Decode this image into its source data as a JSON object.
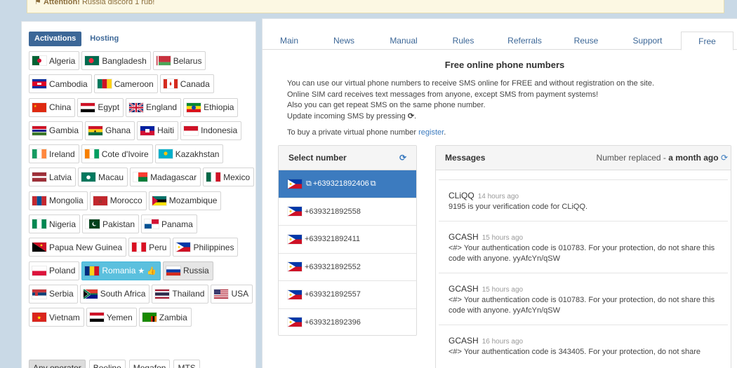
{
  "attention": {
    "label": "Attention!",
    "text": "Russia discord 1 rub!"
  },
  "left_tabs": [
    "Activations",
    "Hosting"
  ],
  "countries": [
    [
      {
        "name": "Algeria",
        "flag": "algeria"
      },
      {
        "name": "Bangladesh",
        "flag": "bangladesh"
      },
      {
        "name": "Belarus",
        "flag": "belarus"
      }
    ],
    [
      {
        "name": "Cambodia",
        "flag": "cambodia"
      },
      {
        "name": "Cameroon",
        "flag": "cameroon"
      },
      {
        "name": "Canada",
        "flag": "canada"
      }
    ],
    [
      {
        "name": "China",
        "flag": "china"
      },
      {
        "name": "Egypt",
        "flag": "egypt"
      },
      {
        "name": "England",
        "flag": "england"
      },
      {
        "name": "Ethiopia",
        "flag": "ethiopia"
      }
    ],
    [
      {
        "name": "Gambia",
        "flag": "gambia"
      },
      {
        "name": "Ghana",
        "flag": "ghana"
      },
      {
        "name": "Haiti",
        "flag": "haiti"
      },
      {
        "name": "Indonesia",
        "flag": "indonesia"
      }
    ],
    [
      {
        "name": "Ireland",
        "flag": "ireland"
      },
      {
        "name": "Cote d'Ivoire",
        "flag": "ivory"
      },
      {
        "name": "Kazakhstan",
        "flag": "kazakhstan"
      }
    ],
    [
      {
        "name": "Latvia",
        "flag": "latvia"
      },
      {
        "name": "Macau",
        "flag": "macau"
      },
      {
        "name": "Madagascar",
        "flag": "madagascar"
      },
      {
        "name": "Mexico",
        "flag": "mexico"
      }
    ],
    [
      {
        "name": "Mongolia",
        "flag": "mongolia"
      },
      {
        "name": "Morocco",
        "flag": "morocco"
      },
      {
        "name": "Mozambique",
        "flag": "mozambique"
      }
    ],
    [
      {
        "name": "Nigeria",
        "flag": "nigeria"
      },
      {
        "name": "Pakistan",
        "flag": "pakistan"
      },
      {
        "name": "Panama",
        "flag": "panama"
      }
    ],
    [
      {
        "name": "Papua New Guinea",
        "flag": "png"
      },
      {
        "name": "Peru",
        "flag": "peru"
      },
      {
        "name": "Philippines",
        "flag": "philippines"
      }
    ],
    [
      {
        "name": "Poland",
        "flag": "poland"
      },
      {
        "name": "Romania",
        "flag": "romania",
        "selected": true,
        "extra": "★ 👍"
      },
      {
        "name": "Russia",
        "flag": "russia",
        "highlight": true
      }
    ],
    [
      {
        "name": "Serbia",
        "flag": "serbia"
      },
      {
        "name": "South Africa",
        "flag": "southafrica"
      },
      {
        "name": "Thailand",
        "flag": "thailand"
      },
      {
        "name": "USA",
        "flag": "usa"
      }
    ],
    [
      {
        "name": "Vietnam",
        "flag": "vietnam"
      },
      {
        "name": "Yemen",
        "flag": "yemen"
      },
      {
        "name": "Zambia",
        "flag": "zambia"
      }
    ]
  ],
  "operators": [
    {
      "label": "Any operator",
      "active": true
    },
    {
      "label": "Beeline"
    },
    {
      "label": "Megafon"
    },
    {
      "label": "MTS"
    }
  ],
  "right_tabs": [
    "Main",
    "News",
    "Manual",
    "Rules",
    "Referrals",
    "Reuse",
    "Support",
    "Free"
  ],
  "active_right_tab": "Free",
  "title": "Free online phone numbers",
  "intro": [
    "You can use our virtual phone numbers to receive SMS online for FREE and without registration on the site.",
    "Online SIM card receives text messages from anyone, except SMS from payment systems!",
    "Also you can get repeat SMS on the same phone number.",
    "Update incoming SMS by pressing"
  ],
  "buy": {
    "text": "To buy a private virtual phone number ",
    "link": "register",
    "end": "."
  },
  "select": {
    "header": "Select number"
  },
  "numbers": [
    {
      "value": "+639321892406",
      "active": true
    },
    {
      "value": "+639321892558"
    },
    {
      "value": "+639321892411"
    },
    {
      "value": "+639321892552"
    },
    {
      "value": "+639321892557"
    },
    {
      "value": "+639321892396"
    }
  ],
  "messages_panel": {
    "header": "Messages",
    "replaced_prefix": "Number replaced - ",
    "replaced_when": "a month ago"
  },
  "messages": [
    {
      "sender": "CLiQQ",
      "time": "14 hours ago",
      "text": "9195 is your verification code for CLiQQ."
    },
    {
      "sender": "GCASH",
      "time": "15 hours ago",
      "text": "<#> Your authentication code is 010783. For your protection, do not share this code with anyone. yyAfcYn/qSW"
    },
    {
      "sender": "GCASH",
      "time": "15 hours ago",
      "text": "<#> Your authentication code is 010783. For your protection, do not share this code with anyone. yyAfcYn/qSW"
    },
    {
      "sender": "GCASH",
      "time": "16 hours ago",
      "text": "<#> Your authentication code is 343405. For your protection, do not share"
    }
  ]
}
